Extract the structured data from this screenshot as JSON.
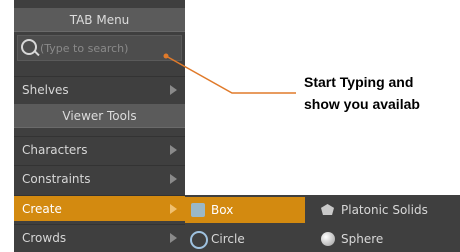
{
  "menu": {
    "title": "TAB Menu",
    "search_placeholder": "(Type to search)",
    "shelves_label": "Shelves",
    "section_header": "Viewer Tools",
    "items": [
      {
        "label": "Characters"
      },
      {
        "label": "Constraints"
      },
      {
        "label": "Create"
      },
      {
        "label": "Crowds"
      }
    ]
  },
  "submenu": {
    "items": [
      {
        "label": "Box",
        "icon": "box-icon"
      },
      {
        "label": "Platonic Solids",
        "icon": "platonic-solids-icon"
      },
      {
        "label": "Circle",
        "icon": "circle-icon"
      },
      {
        "label": "Sphere",
        "icon": "sphere-icon"
      }
    ]
  },
  "annotation": {
    "line1": "Start Typing and",
    "line2": "show you availab"
  },
  "colors": {
    "menu_bg": "#3f3f3f",
    "header_bg": "#5b5b5b",
    "highlight": "#d38a10",
    "callout_line": "#e07a2a"
  }
}
